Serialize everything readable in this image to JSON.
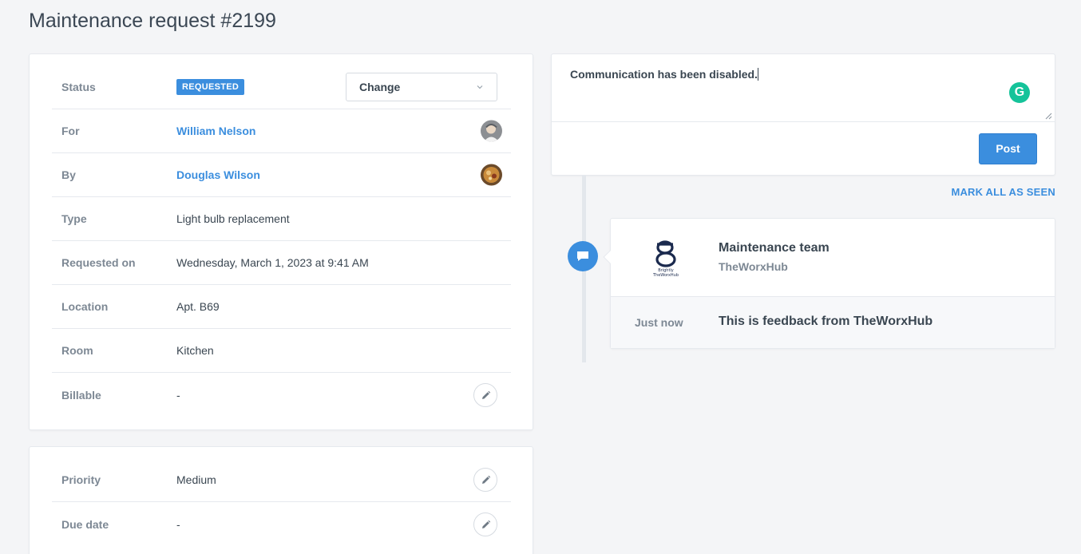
{
  "page": {
    "title": "Maintenance request #2199"
  },
  "details": {
    "status": {
      "label": "Status",
      "badge": "REQUESTED",
      "change_label": "Change"
    },
    "rows": [
      {
        "label": "For",
        "value": "William Nelson"
      },
      {
        "label": "By",
        "value": "Douglas Wilson"
      },
      {
        "label": "Type",
        "value": "Light bulb replacement"
      },
      {
        "label": "Requested on",
        "value": "Wednesday, March 1, 2023 at 9:41 AM"
      },
      {
        "label": "Location",
        "value": "Apt. B69"
      },
      {
        "label": "Room",
        "value": "Kitchen"
      },
      {
        "label": "Billable",
        "value": "-"
      }
    ]
  },
  "details2": {
    "rows": [
      {
        "label": "Priority",
        "value": "Medium"
      },
      {
        "label": "Due date",
        "value": "-"
      }
    ]
  },
  "comment": {
    "text": "Communication has been disabled.",
    "post_label": "Post"
  },
  "feed": {
    "mark_all_label": "MARK ALL AS SEEN",
    "entry": {
      "title": "Maintenance team",
      "subtitle": "TheWorxHub",
      "logo_text_1": "Brightly",
      "logo_text_2": "TheWorxHub",
      "time": "Just now",
      "message": "This is feedback from TheWorxHub"
    }
  },
  "colors": {
    "accent": "#3b8ede",
    "grammarly": "#15c39a"
  }
}
